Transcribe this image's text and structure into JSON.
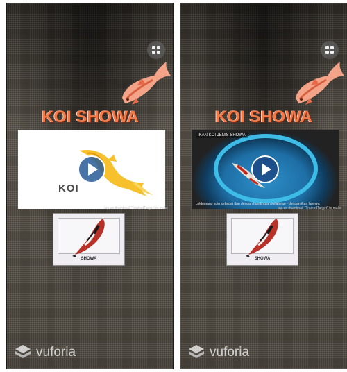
{
  "screens": [
    {
      "title": "KOI SHOWA",
      "video": {
        "kind": "thumbnail",
        "brand": "KOI",
        "video_title": "",
        "caption": ""
      },
      "hint": "tap on thumbnail \"TrainedTarget\" to make",
      "card_label": "SHOWA",
      "vuforia_label": "vuforia"
    },
    {
      "title": "KOI SHOWA",
      "video": {
        "kind": "playing",
        "brand": "",
        "video_title": "IKAN KOI JENIS SHOWA",
        "caption": "coldemang koin sebagai dan dengan bandingtan kelahiran - dengan ikan lainnya"
      },
      "hint": "tap on thumbnail \"TrainedTarget\" to make",
      "card_label": "SHOWA",
      "vuforia_label": "vuforia"
    }
  ],
  "icons": {
    "menu": "grid-menu-icon",
    "play": "play-icon",
    "logo": "vuforia-logo-icon",
    "koi": "koi-fish-icon"
  },
  "colors": {
    "title": "#f07a4a",
    "koi_accent": "#e85a3a",
    "play_button": "#2a6aa6",
    "bowl": "#3dbce8"
  }
}
